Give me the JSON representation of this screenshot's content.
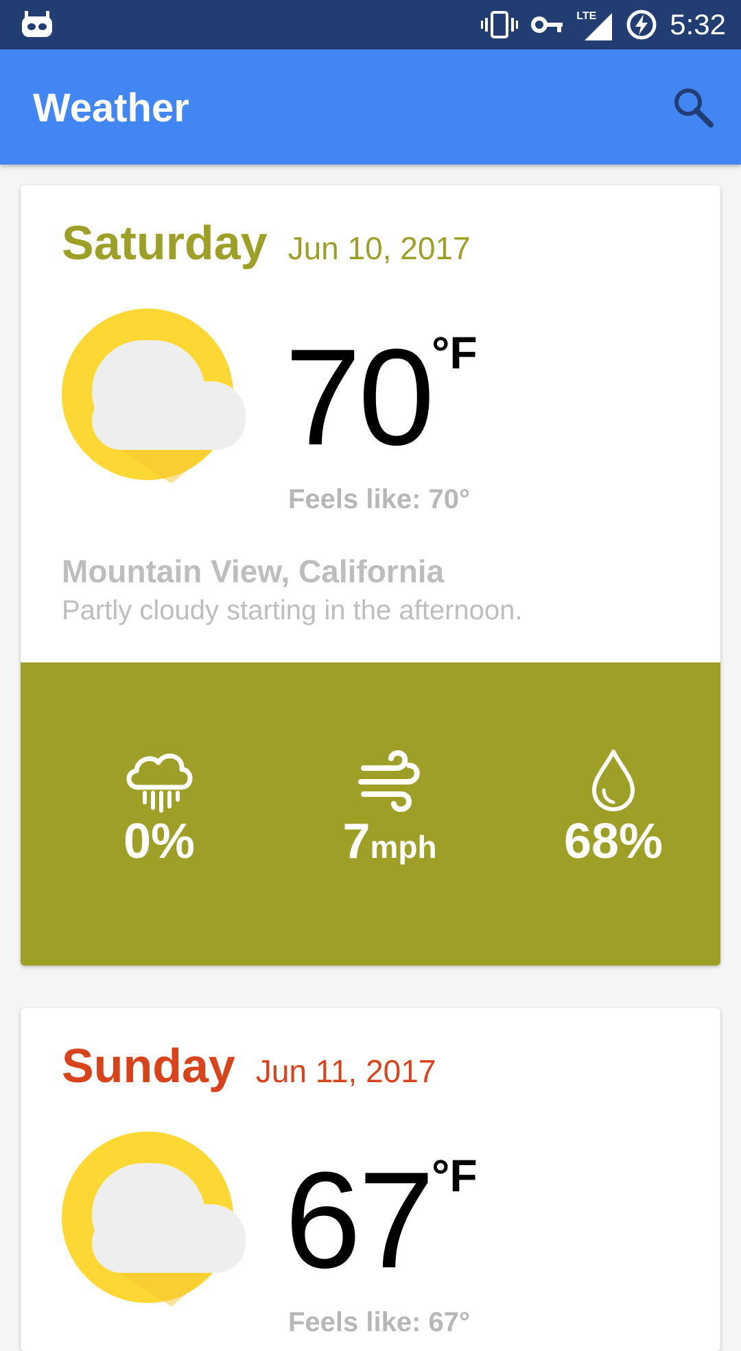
{
  "status_bar": {
    "time": "5:32",
    "network": "LTE"
  },
  "app_bar": {
    "title": "Weather"
  },
  "cards": [
    {
      "day": "Saturday",
      "date": "Jun 10, 2017",
      "temperature": "70",
      "unit": "°F",
      "feels_like": "Feels like: 70°",
      "location": "Mountain View, California",
      "summary": "Partly cloudy starting in the afternoon.",
      "precipitation": "0%",
      "wind_value": "7",
      "wind_unit": "mph",
      "humidity": "68%",
      "accent_color": "#9d9f27",
      "condition_icon": "partly-cloudy-icon"
    },
    {
      "day": "Sunday",
      "date": "Jun 11, 2017",
      "temperature": "67",
      "unit": "°F",
      "feels_like": "Feels like: 67°",
      "accent_color": "#d9431c",
      "condition_icon": "partly-cloudy-icon"
    }
  ],
  "colors": {
    "status_bar": "#213d72",
    "app_bar": "#4286f4"
  }
}
